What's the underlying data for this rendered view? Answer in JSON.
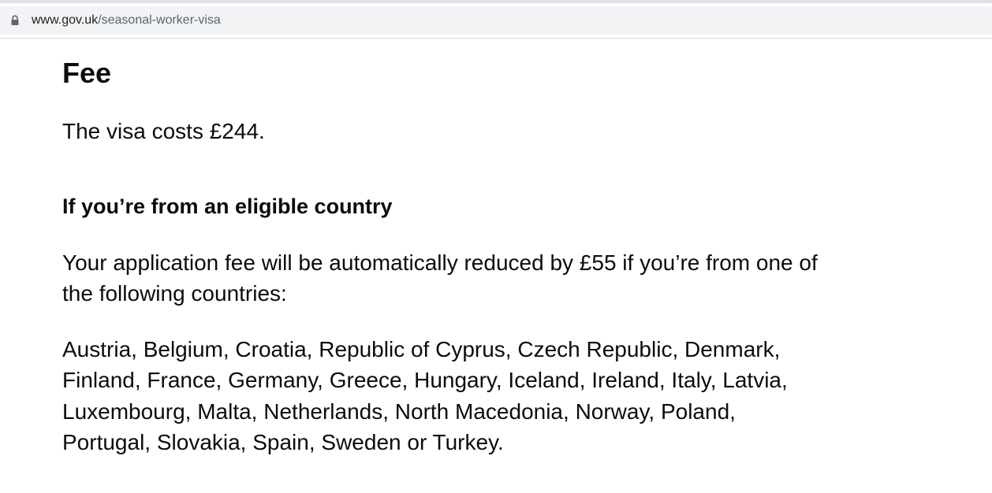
{
  "browser": {
    "url_host": "www.gov.uk",
    "url_path": "/seasonal-worker-visa",
    "lock_icon": "lock-icon"
  },
  "page": {
    "heading_fee": "Fee",
    "visa_cost_text": "The visa costs £244.",
    "eligible_heading": "If you’re from an eligible country",
    "reduced_fee_lines": [
      "Your application fee will be automatically reduced by £55 if you’re from one of",
      "the following countries:"
    ],
    "countries_lines": [
      "Austria, Belgium, Croatia, Republic of Cyprus, Czech Republic, Denmark,",
      "Finland, France, Germany, Greece, Hungary, Iceland, Ireland, Italy, Latvia,",
      "Luxembourg, Malta, Netherlands, North Macedonia, Norway, Poland,",
      "Portugal, Slovakia, Spain, Sweden or Turkey."
    ]
  },
  "colors": {
    "text": "#0b0c0c",
    "url_host": "#202124",
    "url_path": "#5f6368",
    "address_bg": "#f1f3f4"
  }
}
